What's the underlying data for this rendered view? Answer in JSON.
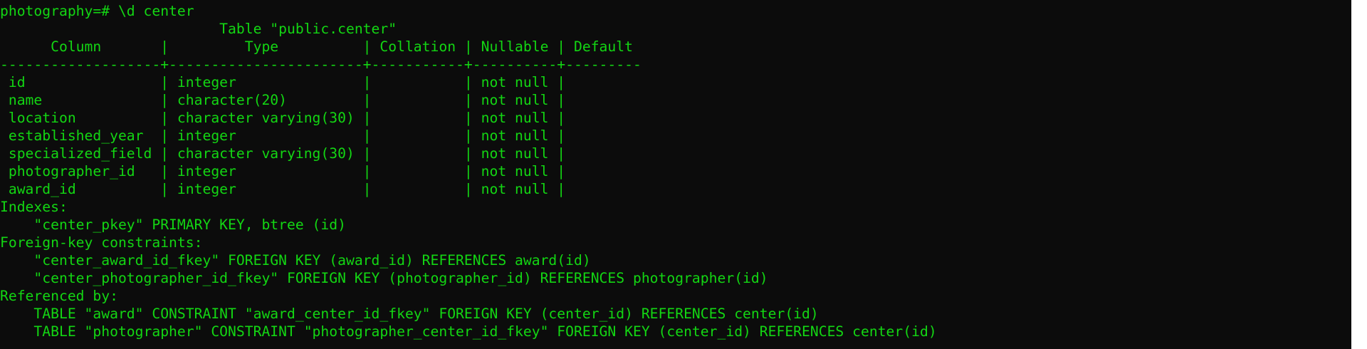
{
  "terminal": {
    "text_color": "#13d613",
    "background_color": "#0c0c0c",
    "lines": [
      "photography=# \\d center",
      "                          Table \"public.center\"",
      "      Column       |         Type          | Collation | Nullable | Default",
      "-------------------+-----------------------+-----------+----------+---------",
      " id                | integer               |           | not null |",
      " name              | character(20)         |           | not null |",
      " location          | character varying(30) |           | not null |",
      " established_year  | integer               |           | not null |",
      " specialized_field | character varying(30) |           | not null |",
      " photographer_id   | integer               |           | not null |",
      " award_id          | integer               |           | not null |",
      "Indexes:",
      "    \"center_pkey\" PRIMARY KEY, btree (id)",
      "Foreign-key constraints:",
      "    \"center_award_id_fkey\" FOREIGN KEY (award_id) REFERENCES award(id)",
      "    \"center_photographer_id_fkey\" FOREIGN KEY (photographer_id) REFERENCES photographer(id)",
      "Referenced by:",
      "    TABLE \"award\" CONSTRAINT \"award_center_id_fkey\" FOREIGN KEY (center_id) REFERENCES center(id)",
      "    TABLE \"photographer\" CONSTRAINT \"photographer_center_id_fkey\" FOREIGN KEY (center_id) REFERENCES center(id)"
    ]
  }
}
